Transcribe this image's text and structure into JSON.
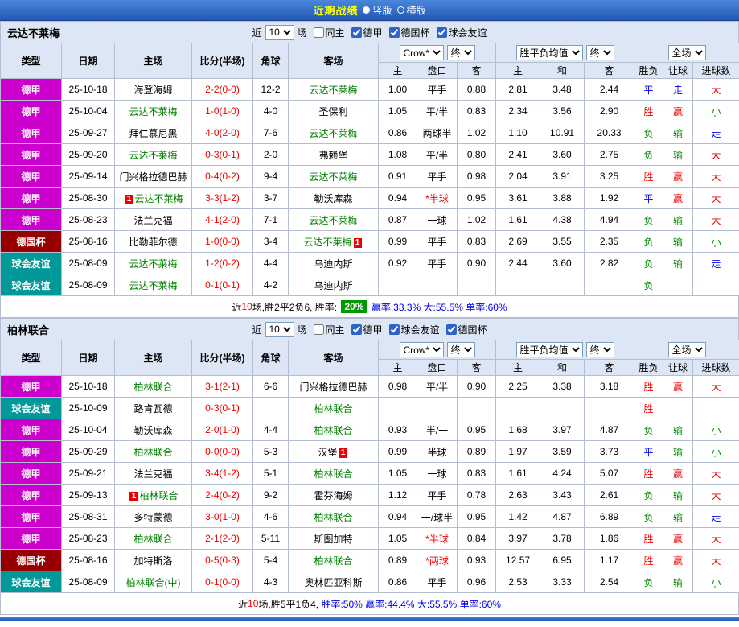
{
  "topbar": {
    "title": "近期战绩",
    "layout_options": [
      {
        "label": "竖版",
        "selected": true
      },
      {
        "label": "横版",
        "selected": false
      }
    ]
  },
  "type_colors": {
    "德甲": "#cc00cc",
    "德国杯": "#980000",
    "球会友谊": "#009898"
  },
  "result_colors": {
    "胜": "#ee0000",
    "赢": "#ee0000",
    "大": "#ee0000",
    "负": "#008800",
    "输": "#008800",
    "小": "#008800",
    "平": "#0000ee",
    "走": "#0000ee"
  },
  "sections": [
    {
      "team": "云达不莱梅",
      "filter": {
        "near": "近",
        "count": "10",
        "games": "场",
        "same_venue": {
          "label": "同主",
          "checked": false
        },
        "leagues": [
          {
            "label": "德甲",
            "checked": true
          },
          {
            "label": "德国杯",
            "checked": true
          },
          {
            "label": "球会友谊",
            "checked": true
          }
        ]
      },
      "header": {
        "cols": [
          "类型",
          "日期",
          "主场",
          "比分(半场)",
          "角球",
          "客场"
        ],
        "bookmaker": "Crow*",
        "final1": "终",
        "avg": "胜平负均值",
        "final2": "终",
        "fulltime": "全场",
        "sub": [
          "主",
          "盘口",
          "客",
          "主",
          "和",
          "客",
          "胜负",
          "让球",
          "进球数"
        ]
      },
      "rows": [
        {
          "type": "德甲",
          "date": "25-10-18",
          "home": "海登海姆",
          "score": "2-2(0-0)",
          "corners": "12-2",
          "away": "云达不莱梅",
          "away_tracked": true,
          "odds": [
            "1.00",
            "平手",
            "0.88"
          ],
          "avg": [
            "2.81",
            "3.48",
            "2.44"
          ],
          "res": [
            "平",
            "走",
            "大"
          ]
        },
        {
          "type": "德甲",
          "date": "25-10-04",
          "home": "云达不莱梅",
          "home_tracked": true,
          "score": "1-0(1-0)",
          "corners": "4-0",
          "away": "圣保利",
          "odds": [
            "1.05",
            "平/半",
            "0.83"
          ],
          "avg": [
            "2.34",
            "3.56",
            "2.90"
          ],
          "res": [
            "胜",
            "赢",
            "小"
          ]
        },
        {
          "type": "德甲",
          "date": "25-09-27",
          "home": "拜仁慕尼黑",
          "score": "4-0(2-0)",
          "corners": "7-6",
          "away": "云达不莱梅",
          "away_tracked": true,
          "odds": [
            "0.86",
            "两球半",
            "1.02"
          ],
          "avg": [
            "1.10",
            "10.91",
            "20.33"
          ],
          "res": [
            "负",
            "输",
            "走"
          ]
        },
        {
          "type": "德甲",
          "date": "25-09-20",
          "home": "云达不莱梅",
          "home_tracked": true,
          "score": "0-3(0-1)",
          "corners": "2-0",
          "away": "弗赖堡",
          "odds": [
            "1.08",
            "平/半",
            "0.80"
          ],
          "avg": [
            "2.41",
            "3.60",
            "2.75"
          ],
          "res": [
            "负",
            "输",
            "大"
          ]
        },
        {
          "type": "德甲",
          "date": "25-09-14",
          "home": "门兴格拉德巴赫",
          "score": "0-4(0-2)",
          "corners": "9-4",
          "away": "云达不莱梅",
          "away_tracked": true,
          "odds": [
            "0.91",
            "平手",
            "0.98"
          ],
          "avg": [
            "2.04",
            "3.91",
            "3.25"
          ],
          "res": [
            "胜",
            "赢",
            "大"
          ]
        },
        {
          "type": "德甲",
          "date": "25-08-30",
          "home": "云达不莱梅",
          "home_tracked": true,
          "home_badge_before": "1",
          "score": "3-3(1-2)",
          "corners": "3-7",
          "away": "勒沃库森",
          "odds": [
            "0.94",
            "*半球",
            "0.95"
          ],
          "avg": [
            "3.61",
            "3.88",
            "1.92"
          ],
          "res": [
            "平",
            "赢",
            "大"
          ]
        },
        {
          "type": "德甲",
          "date": "25-08-23",
          "home": "法兰克福",
          "score": "4-1(2-0)",
          "corners": "7-1",
          "away": "云达不莱梅",
          "away_tracked": true,
          "odds": [
            "0.87",
            "一球",
            "1.02"
          ],
          "avg": [
            "1.61",
            "4.38",
            "4.94"
          ],
          "res": [
            "负",
            "输",
            "大"
          ]
        },
        {
          "type": "德国杯",
          "date": "25-08-16",
          "home": "比勒菲尔德",
          "score": "1-0(0-0)",
          "corners": "3-4",
          "away": "云达不莱梅",
          "away_tracked": true,
          "away_badge_after": "1",
          "odds": [
            "0.99",
            "平手",
            "0.83"
          ],
          "avg": [
            "2.69",
            "3.55",
            "2.35"
          ],
          "res": [
            "负",
            "输",
            "小"
          ]
        },
        {
          "type": "球会友谊",
          "date": "25-08-09",
          "home": "云达不莱梅",
          "home_tracked": true,
          "score": "1-2(0-2)",
          "corners": "4-4",
          "away": "乌迪内斯",
          "odds": [
            "0.92",
            "平手",
            "0.90"
          ],
          "avg": [
            "2.44",
            "3.60",
            "2.82"
          ],
          "res": [
            "负",
            "输",
            "走"
          ]
        },
        {
          "type": "球会友谊",
          "date": "25-08-09",
          "home": "云达不莱梅",
          "home_tracked": true,
          "score": "0-1(0-1)",
          "corners": "4-2",
          "away": "乌迪内斯",
          "odds": [
            "",
            "",
            ""
          ],
          "avg": [
            "",
            "",
            ""
          ],
          "res": [
            "负",
            "",
            ""
          ]
        }
      ],
      "footer": [
        {
          "t": "近"
        },
        {
          "t": "10",
          "s": "red"
        },
        {
          "t": "场,胜2平2负6, 胜率: "
        },
        {
          "t": "20%",
          "s": "badge"
        },
        {
          "t": " 赢率:33.3% ",
          "s": "blue"
        },
        {
          "t": "大:55.5% ",
          "s": "blue"
        },
        {
          "t": "单率:60%",
          "s": "blue"
        }
      ]
    },
    {
      "team": "柏林联合",
      "filter": {
        "near": "近",
        "count": "10",
        "games": "场",
        "same_venue": {
          "label": "同主",
          "checked": false
        },
        "leagues": [
          {
            "label": "德甲",
            "checked": true
          },
          {
            "label": "球会友谊",
            "checked": true
          },
          {
            "label": "德国杯",
            "checked": true
          }
        ]
      },
      "header": {
        "cols": [
          "类型",
          "日期",
          "主场",
          "比分(半场)",
          "角球",
          "客场"
        ],
        "bookmaker": "Crow*",
        "final1": "终",
        "avg": "胜平负均值",
        "final2": "终",
        "fulltime": "全场",
        "sub": [
          "主",
          "盘口",
          "客",
          "主",
          "和",
          "客",
          "胜负",
          "让球",
          "进球数"
        ]
      },
      "rows": [
        {
          "type": "德甲",
          "date": "25-10-18",
          "home": "柏林联合",
          "home_tracked": true,
          "score": "3-1(2-1)",
          "corners": "6-6",
          "away": "门兴格拉德巴赫",
          "odds": [
            "0.98",
            "平/半",
            "0.90"
          ],
          "avg": [
            "2.25",
            "3.38",
            "3.18"
          ],
          "res": [
            "胜",
            "赢",
            "大"
          ]
        },
        {
          "type": "球会友谊",
          "date": "25-10-09",
          "home": "路肯瓦德",
          "score": "0-3(0-1)",
          "corners": "",
          "away": "柏林联合",
          "away_tracked": true,
          "odds": [
            "",
            "",
            ""
          ],
          "avg": [
            "",
            "",
            ""
          ],
          "res": [
            "胜",
            "",
            ""
          ]
        },
        {
          "type": "德甲",
          "date": "25-10-04",
          "home": "勒沃库森",
          "score": "2-0(1-0)",
          "corners": "4-4",
          "away": "柏林联合",
          "away_tracked": true,
          "odds": [
            "0.93",
            "半/一",
            "0.95"
          ],
          "avg": [
            "1.68",
            "3.97",
            "4.87"
          ],
          "res": [
            "负",
            "输",
            "小"
          ]
        },
        {
          "type": "德甲",
          "date": "25-09-29",
          "home": "柏林联合",
          "home_tracked": true,
          "score": "0-0(0-0)",
          "corners": "5-3",
          "away": "汉堡",
          "away_badge_after": "1",
          "odds": [
            "0.99",
            "半球",
            "0.89"
          ],
          "avg": [
            "1.97",
            "3.59",
            "3.73"
          ],
          "res": [
            "平",
            "输",
            "小"
          ]
        },
        {
          "type": "德甲",
          "date": "25-09-21",
          "home": "法兰克福",
          "score": "3-4(1-2)",
          "corners": "5-1",
          "away": "柏林联合",
          "away_tracked": true,
          "odds": [
            "1.05",
            "一球",
            "0.83"
          ],
          "avg": [
            "1.61",
            "4.24",
            "5.07"
          ],
          "res": [
            "胜",
            "赢",
            "大"
          ]
        },
        {
          "type": "德甲",
          "date": "25-09-13",
          "home": "柏林联合",
          "home_tracked": true,
          "home_badge_before": "1",
          "score": "2-4(0-2)",
          "corners": "9-2",
          "away": "霍芬海姆",
          "odds": [
            "1.12",
            "平手",
            "0.78"
          ],
          "avg": [
            "2.63",
            "3.43",
            "2.61"
          ],
          "res": [
            "负",
            "输",
            "大"
          ]
        },
        {
          "type": "德甲",
          "date": "25-08-31",
          "home": "多特蒙德",
          "score": "3-0(1-0)",
          "corners": "4-6",
          "away": "柏林联合",
          "away_tracked": true,
          "odds": [
            "0.94",
            "一/球半",
            "0.95"
          ],
          "avg": [
            "1.42",
            "4.87",
            "6.89"
          ],
          "res": [
            "负",
            "输",
            "走"
          ]
        },
        {
          "type": "德甲",
          "date": "25-08-23",
          "home": "柏林联合",
          "home_tracked": true,
          "score": "2-1(2-0)",
          "corners": "5-11",
          "away": "斯图加特",
          "odds": [
            "1.05",
            "*半球",
            "0.84"
          ],
          "avg": [
            "3.97",
            "3.78",
            "1.86"
          ],
          "res": [
            "胜",
            "赢",
            "大"
          ]
        },
        {
          "type": "德国杯",
          "date": "25-08-16",
          "home": "加特斯洛",
          "score": "0-5(0-3)",
          "corners": "5-4",
          "away": "柏林联合",
          "away_tracked": true,
          "odds": [
            "0.89",
            "*两球",
            "0.93"
          ],
          "avg": [
            "12.57",
            "6.95",
            "1.17"
          ],
          "res": [
            "胜",
            "赢",
            "大"
          ]
        },
        {
          "type": "球会友谊",
          "date": "25-08-09",
          "home": "柏林联合(中)",
          "home_tracked": true,
          "score": "0-1(0-0)",
          "corners": "4-3",
          "away": "奥林匹亚科斯",
          "odds": [
            "0.86",
            "平手",
            "0.96"
          ],
          "avg": [
            "2.53",
            "3.33",
            "2.54"
          ],
          "res": [
            "负",
            "输",
            "小"
          ]
        }
      ],
      "footer": [
        {
          "t": "近"
        },
        {
          "t": "10",
          "s": "red"
        },
        {
          "t": "场,胜5平1负4, "
        },
        {
          "t": "胜率:50% ",
          "s": "blue"
        },
        {
          "t": "赢率:44.4% ",
          "s": "blue"
        },
        {
          "t": "大:55.5% ",
          "s": "blue"
        },
        {
          "t": "单率:60%",
          "s": "blue"
        }
      ]
    }
  ]
}
